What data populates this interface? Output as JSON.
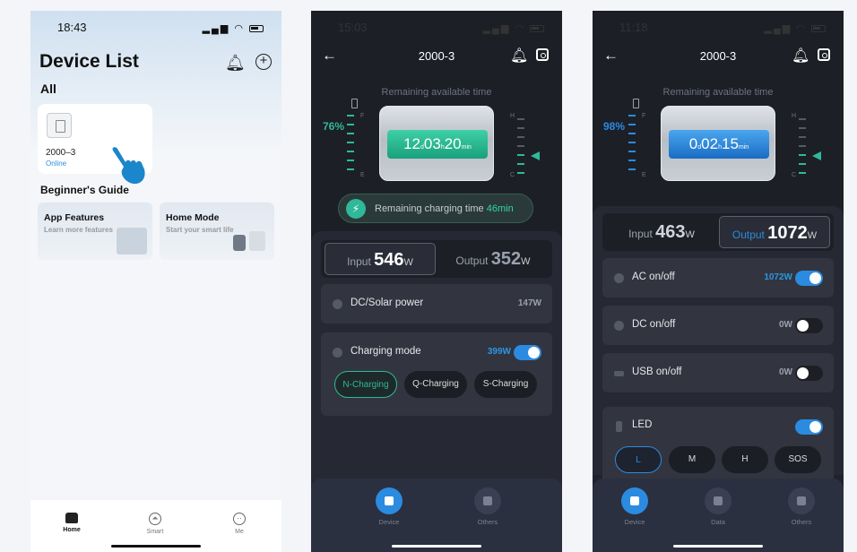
{
  "p1": {
    "time": "18:43",
    "title": "Device List",
    "all": "All",
    "device": {
      "name": "2000–3",
      "status": "Online"
    },
    "guide": "Beginner's Guide",
    "cards": [
      {
        "title": "App Features",
        "sub": "Learn more features"
      },
      {
        "title": "Home Mode",
        "sub": "Start your smart life"
      }
    ],
    "nav": [
      "Home",
      "Smart",
      "Me"
    ]
  },
  "p2": {
    "time": "15:03",
    "title": "2000-3",
    "remain": "Remaining available time",
    "pct": "76%",
    "t_d": "12",
    "t_h": "03",
    "t_m": "20",
    "charging_label": "Remaining charging time",
    "charging_val": "46min",
    "input_label": "Input",
    "input_val": "546",
    "output_label": "Output",
    "output_val": "352",
    "unit": "W",
    "dc_label": "DC/Solar power",
    "dc_val": "147W",
    "mode_label": "Charging mode",
    "mode_val": "399W",
    "chips": [
      "N-Charging",
      "Q-Charging",
      "S-Charging"
    ],
    "nav": [
      "Device",
      "Others"
    ]
  },
  "p3": {
    "time": "11:18",
    "title": "2000-3",
    "remain": "Remaining available time",
    "pct": "98%",
    "t_d": "0",
    "t_h": "02",
    "t_m": "15",
    "input_label": "Input",
    "input_val": "463",
    "output_label": "Output",
    "output_val": "1072",
    "unit": "W",
    "ac_label": "AC on/off",
    "ac_val": "1072W",
    "dc_label": "DC on/off",
    "dc_val": "0W",
    "usb_label": "USB on/off",
    "usb_val": "0W",
    "led_label": "LED",
    "led_modes": [
      "L",
      "M",
      "H",
      "SOS"
    ],
    "nav": [
      "Device",
      "Data",
      "Others"
    ]
  },
  "colors": {
    "teal": "#2fb99a",
    "blue": "#2b8be0",
    "bg_dark": "#21232c"
  }
}
